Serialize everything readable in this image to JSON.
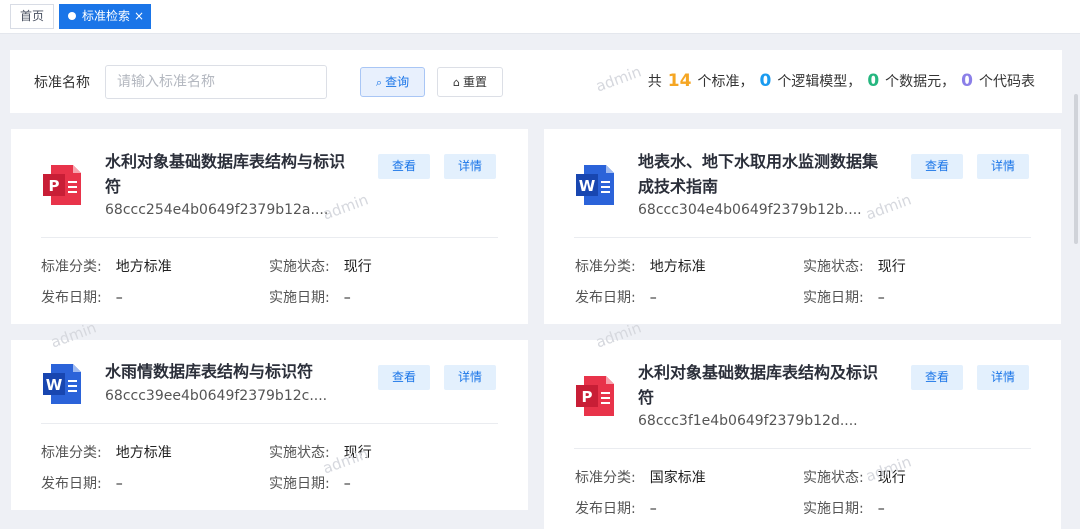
{
  "tabs": {
    "home": "首页",
    "active": "标准检索",
    "close": "×"
  },
  "search": {
    "label": "标准名称",
    "placeholder": "请输入标准名称",
    "query_btn": "查询",
    "reset_btn": "重置"
  },
  "stats": {
    "prefix": "共",
    "standards_count": "14",
    "standards_label": "个标准，",
    "logic_count": "0",
    "logic_label": "个逻辑模型，",
    "elements_count": "0",
    "elements_label": "个数据元，",
    "codes_count": "0",
    "codes_label": "个代码表"
  },
  "colors": {
    "accent": "#1a75e8",
    "orange": "#f5a623",
    "blue": "#1a9bf0",
    "green": "#25b67f",
    "purple": "#8b7fe8",
    "pdf_red": "#e8334a",
    "word_blue": "#2b63d9"
  },
  "watermark": "admin",
  "card_labels": {
    "view": "查看",
    "detail": "详情",
    "category_label": "标准分类:",
    "status_label": "实施状态:",
    "publish_label": "发布日期:",
    "impl_label": "实施日期:"
  },
  "cards": [
    {
      "icon": "pdf-icon",
      "title": "水利对象基础数据库表结构与标识符",
      "id": "68ccc254e4b0649f2379b12a....",
      "category": "地方标准",
      "status": "现行",
      "publish_date": "–",
      "impl_date": "–"
    },
    {
      "icon": "word-icon",
      "title": "地表水、地下水取用水监测数据集成技术指南",
      "id": "68ccc304e4b0649f2379b12b....",
      "category": "地方标准",
      "status": "现行",
      "publish_date": "–",
      "impl_date": "–"
    },
    {
      "icon": "word-icon",
      "title": "水雨情数据库表结构与标识符",
      "id": "68ccc39ee4b0649f2379b12c....",
      "category": "地方标准",
      "status": "现行",
      "publish_date": "–",
      "impl_date": "–"
    },
    {
      "icon": "pdf-icon",
      "title": "水利对象基础数据库表结构及标识符",
      "id": "68ccc3f1e4b0649f2379b12d....",
      "category": "国家标准",
      "status": "现行",
      "publish_date": "–",
      "impl_date": "–"
    }
  ]
}
